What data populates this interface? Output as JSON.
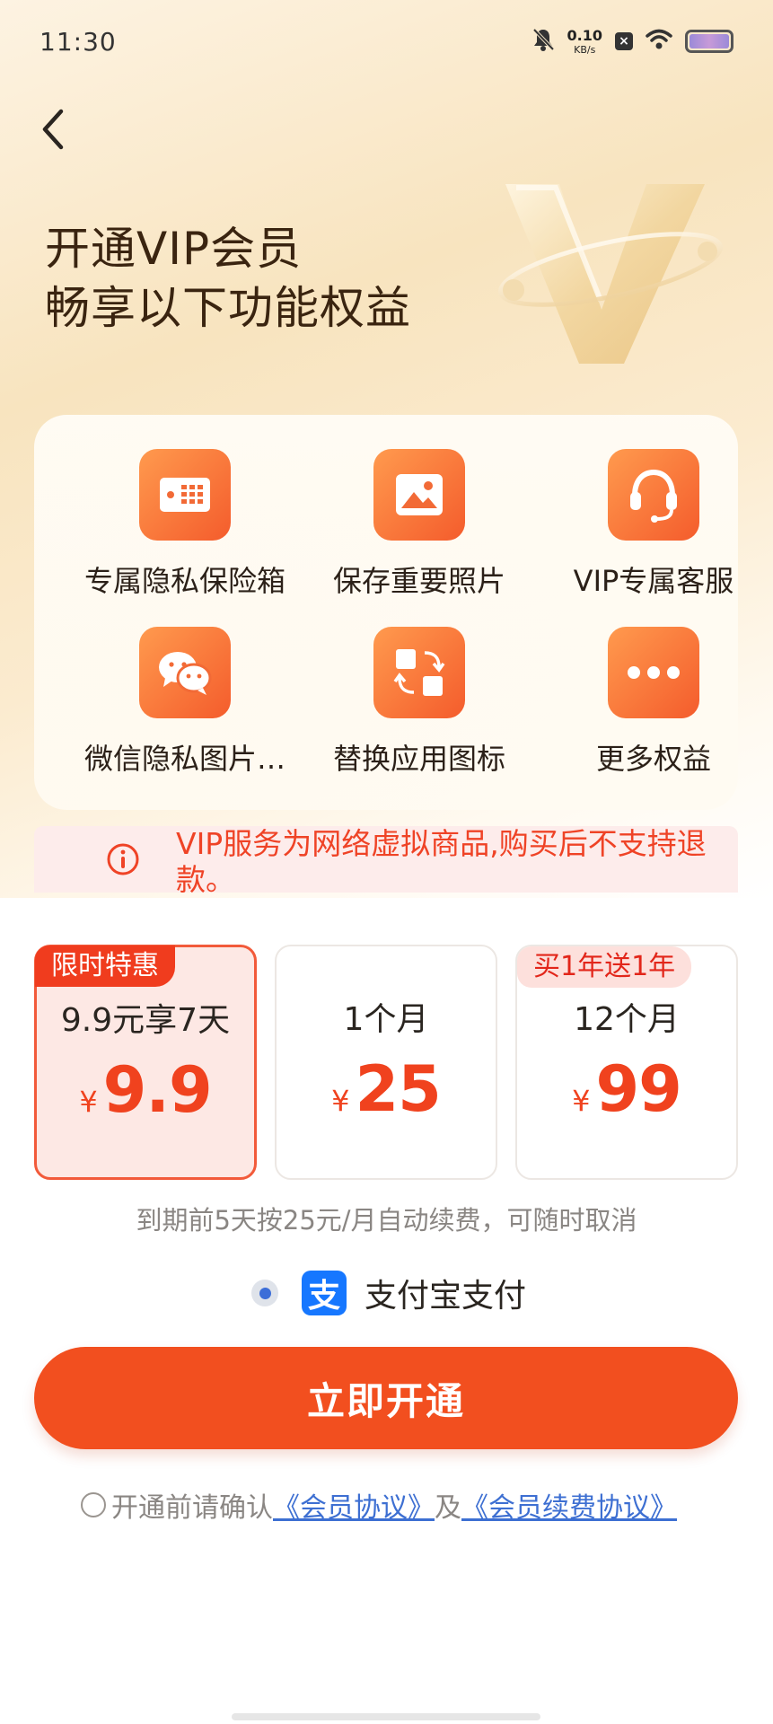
{
  "status_bar": {
    "time": "11:30",
    "net_speed_value": "0.10",
    "net_speed_unit": "KB/s",
    "icons": [
      "bell-muted-icon",
      "net-speed",
      "sim-x-icon",
      "wifi-icon",
      "battery-icon"
    ]
  },
  "nav": {
    "back_icon": "chevron-left-icon"
  },
  "hero": {
    "title_line1": "开通VIP会员",
    "title_line2": "畅享以下功能权益"
  },
  "features": [
    {
      "label": "专属隐私保险箱",
      "icon": "safe-box-icon"
    },
    {
      "label": "保存重要照片",
      "icon": "photo-icon"
    },
    {
      "label": "VIP专属客服",
      "icon": "headset-icon"
    },
    {
      "label": "微信隐私图片…",
      "icon": "wechat-icon"
    },
    {
      "label": "替换应用图标",
      "icon": "swap-icon"
    },
    {
      "label": "更多权益",
      "icon": "more-dots-icon"
    }
  ],
  "notice": {
    "icon": "info-icon",
    "text": "VIP服务为网络虚拟商品,购买后不支持退款。"
  },
  "plans": [
    {
      "badge": "限时特惠",
      "name": "9.9元享7天",
      "currency": "¥",
      "price": "9.9",
      "selected": true
    },
    {
      "badge": "",
      "name": "1个月",
      "currency": "¥",
      "price": "25",
      "selected": false
    },
    {
      "badge": "买1年送1年",
      "name": "12个月",
      "currency": "¥",
      "price": "99",
      "selected": false
    }
  ],
  "renew_note": "到期前5天按25元/月自动续费，可随时取消",
  "payment": {
    "label": "支付宝支付",
    "icon_glyph": "支",
    "selected": true
  },
  "cta": {
    "label": "立即开通"
  },
  "agreement": {
    "prefix": "开通前请确认",
    "link1": "《会员协议》",
    "conj": "及",
    "link2": "《会员续费协议》",
    "checked": false
  },
  "colors": {
    "accent": "#f24f1f",
    "price": "#f0421e",
    "link": "#3d6fd2",
    "notice_bg": "#fdeceb",
    "selected_plan_bg": "#fde8e4"
  }
}
